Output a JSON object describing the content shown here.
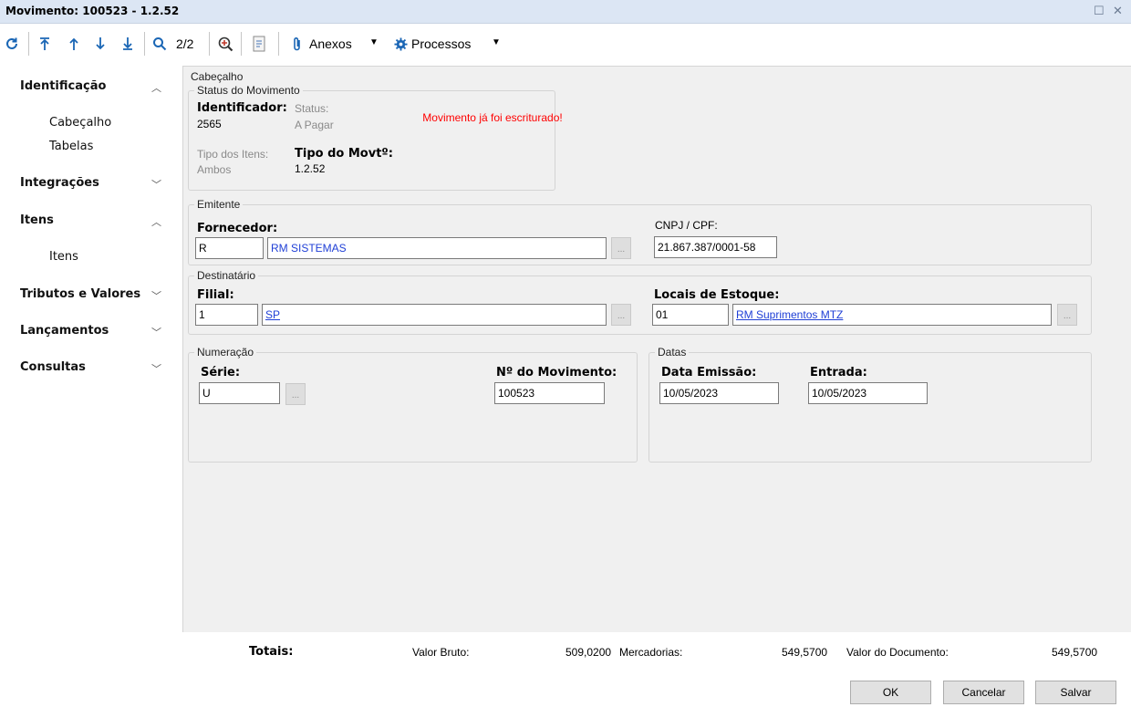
{
  "window": {
    "title": "Movimento: 100523 - 1.2.52"
  },
  "toolbar": {
    "record_position": "2/2",
    "attachments_label": "Anexos",
    "processes_label": "Processos"
  },
  "sidebar": {
    "sections": [
      {
        "label": "Identificação",
        "expanded": true,
        "items": [
          "Cabeçalho",
          "Tabelas"
        ]
      },
      {
        "label": "Integrações",
        "expanded": false
      },
      {
        "label": "Itens",
        "expanded": true,
        "items": [
          "Itens"
        ]
      },
      {
        "label": "Tributos e Valores",
        "expanded": false
      },
      {
        "label": "Lançamentos",
        "expanded": false
      },
      {
        "label": "Consultas",
        "expanded": false
      }
    ]
  },
  "header": {
    "group_label": "Cabeçalho",
    "status_group": {
      "label": "Status do Movimento",
      "identifier_label": "Identificador:",
      "identifier_value": "2565",
      "status_label": "Status:",
      "status_value": "A Pagar",
      "item_type_label": "Tipo dos Itens:",
      "item_type_value": "Ambos",
      "movement_type_label": "Tipo do Movtº:",
      "movement_type_value": "1.2.52",
      "warning": "Movimento já foi escriturado!"
    },
    "issuer": {
      "label": "Emitente",
      "supplier_label": "Fornecedor:",
      "supplier_code": "R",
      "supplier_name": "RM SISTEMAS",
      "cnpj_label": "CNPJ / CPF:",
      "cnpj_value": "21.867.387/0001-58"
    },
    "recipient": {
      "label": "Destinatário",
      "branch_label": "Filial:",
      "branch_code": "1",
      "branch_name": "SP",
      "stock_label": "Locais de Estoque:",
      "stock_code": "01",
      "stock_name": "RM Suprimentos MTZ"
    },
    "numbering": {
      "label": "Numeração",
      "series_label": "Série:",
      "series_value": "U",
      "number_label": "Nº do Movimento:",
      "number_value": "100523"
    },
    "dates": {
      "label": "Datas",
      "issue_label": "Data Emissão:",
      "issue_value": "10/05/2023",
      "entry_label": "Entrada:",
      "entry_value": "10/05/2023"
    },
    "lookup_label": "..."
  },
  "totals": {
    "label": "Totais:",
    "gross_label": "Valor Bruto:",
    "gross_value": "509,0200",
    "goods_label": "Mercadorias:",
    "goods_value": "549,5700",
    "document_label": "Valor do Documento:",
    "document_value": "549,5700"
  },
  "buttons": {
    "ok": "OK",
    "cancel": "Cancelar",
    "save": "Salvar"
  },
  "colors": {
    "accent": "#1a66b5",
    "link": "#1f3fd6",
    "warning": "#ff0000",
    "titlebar": "#dce6f4"
  }
}
